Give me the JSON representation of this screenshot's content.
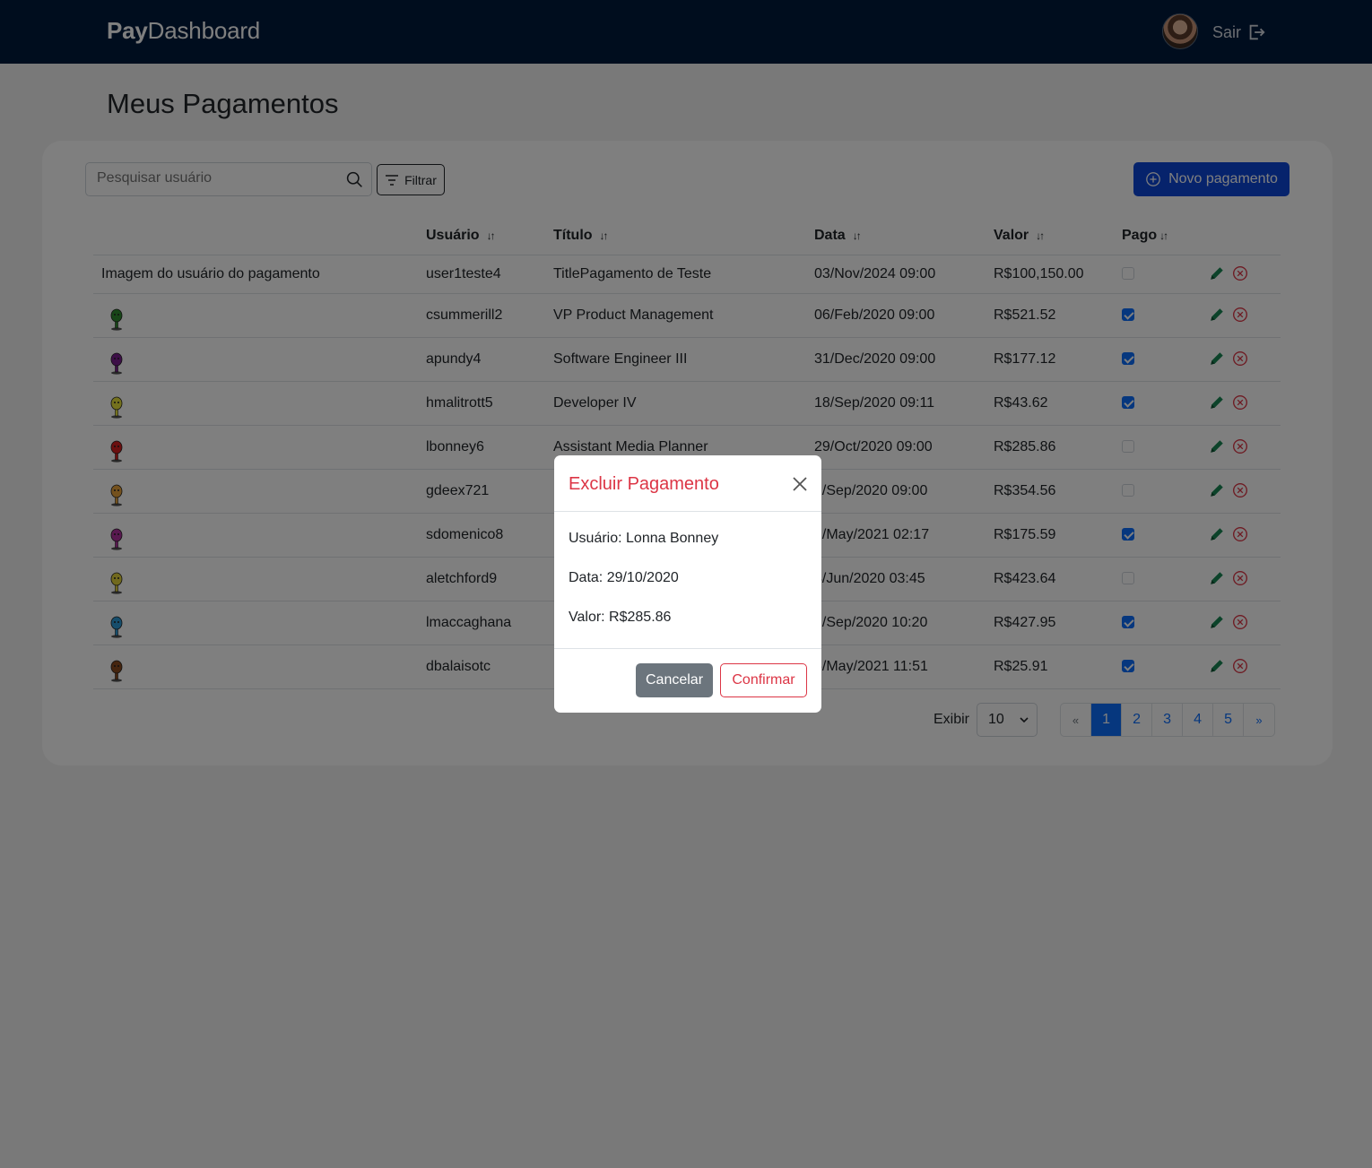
{
  "navbar": {
    "brand_bold": "Pay",
    "brand_rest": "Dashboard",
    "logout_label": "Sair"
  },
  "page": {
    "title": "Meus Pagamentos"
  },
  "toolbar": {
    "search_placeholder": "Pesquisar usuário",
    "filter_label": "Filtrar",
    "new_label": "Novo pagamento"
  },
  "table": {
    "headers": [
      "Usuário",
      "Título",
      "Data",
      "Valor",
      "Pago"
    ],
    "sort_glyph": "↓↑",
    "broken_image_alt": "Imagem do usuário do pagamento",
    "rows": [
      {
        "user": "user1teste4",
        "title": "TitlePagamento de Teste",
        "date": "03/Nov/2024 09:00",
        "value": "R$100,150.00",
        "paid": false
      },
      {
        "user": "csummerill2",
        "title": "VP Product Management",
        "date": "06/Feb/2020 09:00",
        "value": "R$521.52",
        "paid": true,
        "figure_color": "#2e8b2e"
      },
      {
        "user": "apundy4",
        "title": "Software Engineer III",
        "date": "31/Dec/2020 09:00",
        "value": "R$177.12",
        "paid": true,
        "figure_color": "#7a1f8f"
      },
      {
        "user": "hmalitrott5",
        "title": "Developer IV",
        "date": "18/Sep/2020 09:11",
        "value": "R$43.62",
        "paid": true,
        "figure_color": "#e8e23a"
      },
      {
        "user": "lbonney6",
        "title": "Assistant Media Planner",
        "date": "29/Oct/2020 09:00",
        "value": "R$285.86",
        "paid": false,
        "figure_color": "#d61f1f"
      },
      {
        "user": "gdeex721",
        "title": "",
        "date": "1/Sep/2020 09:00",
        "value": "R$354.56",
        "paid": false,
        "figure_color": "#e9a23b"
      },
      {
        "user": "sdomenico8",
        "title": "",
        "date": "2/May/2021 02:17",
        "value": "R$175.59",
        "paid": true,
        "figure_color": "#b0309f"
      },
      {
        "user": "aletchford9",
        "title": "",
        "date": "4/Jun/2020 03:45",
        "value": "R$423.64",
        "paid": false,
        "figure_color": "#e2d33a"
      },
      {
        "user": "lmaccaghana",
        "title": "",
        "date": "2/Sep/2020 10:20",
        "value": "R$427.95",
        "paid": true,
        "figure_color": "#2c9ad6"
      },
      {
        "user": "dbalaisotc",
        "title": "",
        "date": "5/May/2021 11:51",
        "value": "R$25.91",
        "paid": true,
        "figure_color": "#8a4a1f"
      }
    ]
  },
  "pagination": {
    "show_label": "Exibir",
    "page_size": "10",
    "prev": "«",
    "next": "»",
    "pages": [
      "1",
      "2",
      "3",
      "4",
      "5"
    ],
    "active_page": "1"
  },
  "modal": {
    "title": "Excluir Pagamento",
    "user_line": "Usuário: Lonna Bonney",
    "date_line": "Data: 29/10/2020",
    "value_line": "Valor: R$285.86",
    "cancel_label": "Cancelar",
    "confirm_label": "Confirmar"
  },
  "colors": {
    "navbar": "#001a3d",
    "primary": "#0d6efd",
    "danger": "#dc3545",
    "edit": "#198754"
  }
}
